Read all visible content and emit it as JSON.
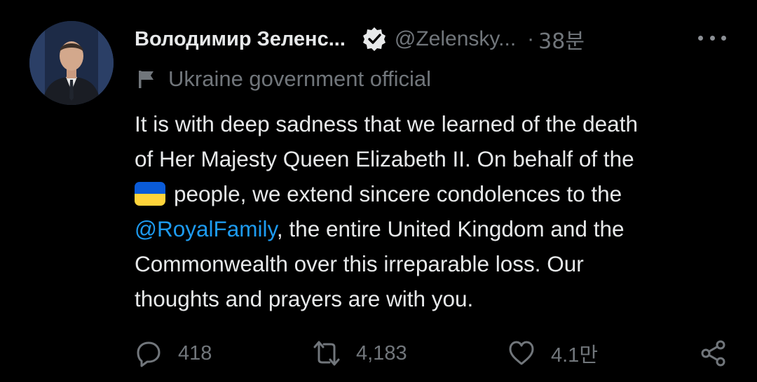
{
  "tweet": {
    "author_name": "Володимир Зеленс...",
    "handle": "@Zelensky...",
    "separator": "·",
    "time": "38분",
    "label": "Ukraine government official",
    "text": {
      "line1": "It is with deep sadness that we learned of the death",
      "line2": "of Her Majesty Queen Elizabeth II. On behalf of the",
      "line3": "people, we extend sincere condolences to the",
      "mention": "@RoyalFamily",
      "line4_rest": ", the entire United Kingdom and the",
      "line5": "Commonwealth over this irreparable loss. Our",
      "line6": "thoughts and prayers are with you."
    },
    "flag_emoji": "ukraine-flag",
    "stats": {
      "replies": "418",
      "retweets": "4,183",
      "likes": "4.1만"
    }
  },
  "icons": {
    "verified": "verified-badge-icon",
    "more": "more-icon",
    "label": "flag-icon",
    "reply": "reply-icon",
    "retweet": "retweet-icon",
    "like": "heart-icon",
    "share": "share-icon"
  },
  "colors": {
    "background": "#000000",
    "text": "#e7e9ea",
    "secondary": "#71767b",
    "link": "#1d9bf0",
    "flag_blue": "#0a5bd8",
    "flag_yellow": "#ffd43b"
  }
}
